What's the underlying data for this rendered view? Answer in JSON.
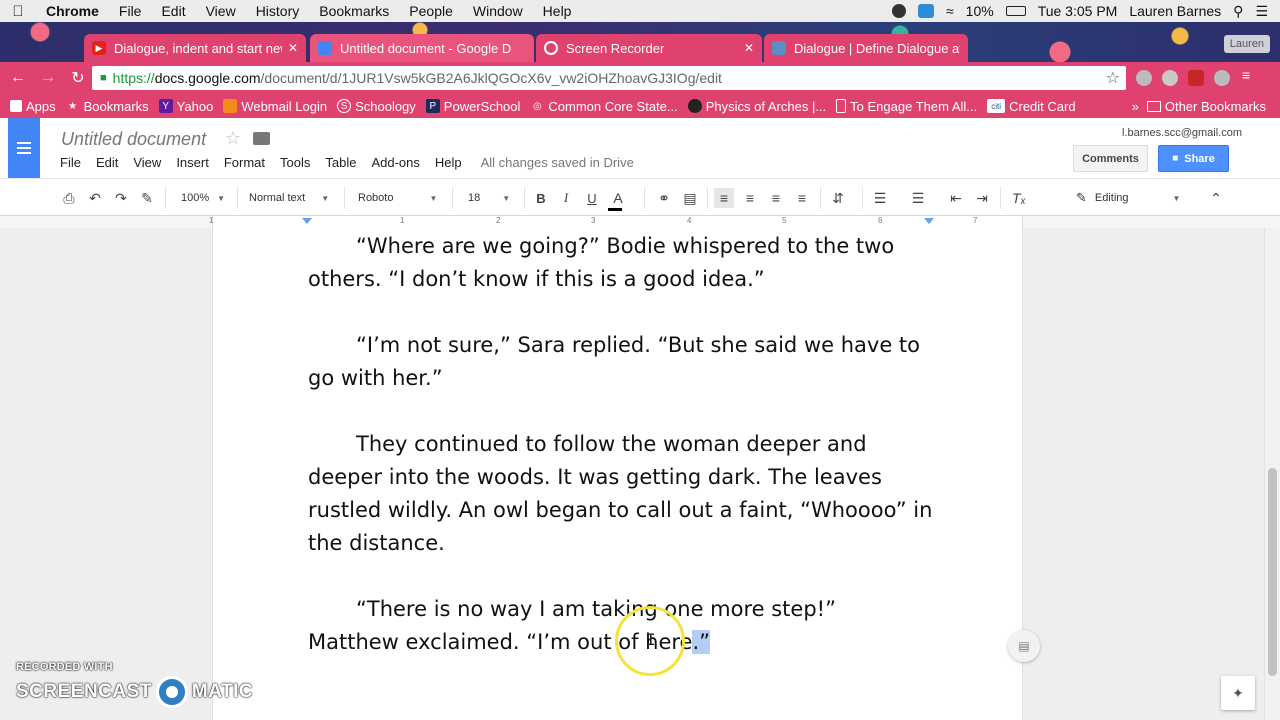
{
  "mac_menu": {
    "app": "Chrome",
    "items": [
      "File",
      "Edit",
      "View",
      "History",
      "Bookmarks",
      "People",
      "Window",
      "Help"
    ],
    "battery": "10%",
    "clock": "Tue 3:05 PM",
    "user": "Lauren Barnes"
  },
  "tabs": [
    {
      "title": "Dialogue, indent and start new",
      "icon": "youtube-icon"
    },
    {
      "title": "Untitled document - Google D",
      "icon": "docs-icon"
    },
    {
      "title": "Screen Recorder",
      "icon": "recorder-icon"
    },
    {
      "title": "Dialogue | Define Dialogue at D",
      "icon": "dictionary-icon"
    }
  ],
  "profile_label": "Lauren",
  "omnibox": {
    "scheme": "https://",
    "host": "docs.google.com",
    "path": "/document/d/1JUR1Vsw5kGB2A6JklQGOcX6v_vw2iOHZhoavGJ3IOg/edit"
  },
  "bookmarks": [
    {
      "label": "Apps",
      "icon": "apps-grid-icon"
    },
    {
      "label": "Bookmarks",
      "icon": "star-icon"
    },
    {
      "label": "Yahoo",
      "icon": "yahoo-icon"
    },
    {
      "label": "Webmail Login",
      "icon": "webmail-icon"
    },
    {
      "label": "Schoology",
      "icon": "schoology-icon"
    },
    {
      "label": "PowerSchool",
      "icon": "powerschool-icon"
    },
    {
      "label": "Common Core State...",
      "icon": "commoncore-icon"
    },
    {
      "label": "Physics of Arches |...",
      "icon": "pbs-icon"
    },
    {
      "label": "To Engage Them All...",
      "icon": "page-icon"
    },
    {
      "label": "Credit Card",
      "icon": "citi-icon"
    }
  ],
  "other_bookmarks": "Other Bookmarks",
  "docs": {
    "title": "Untitled document",
    "menus": [
      "File",
      "Edit",
      "View",
      "Insert",
      "Format",
      "Tools",
      "Table",
      "Add-ons",
      "Help"
    ],
    "save_status": "All changes saved in Drive",
    "account": "l.barnes.scc@gmail.com",
    "comments_label": "Comments",
    "share_label": "Share"
  },
  "toolbar": {
    "zoom": "100%",
    "style": "Normal text",
    "font": "Roboto",
    "size": "18",
    "mode": "Editing"
  },
  "ruler_numbers": [
    "1",
    "1",
    "2",
    "3",
    "4",
    "5",
    "6",
    "7"
  ],
  "document": {
    "paragraphs": [
      "“Where are we going?” Bodie whispered to the two others. “I don’t know if this is a good idea.”",
      "“I’m not sure,” Sara replied. “But she said we have to go with her.”",
      "They continued to follow the woman deeper and deeper into the woods. It was getting dark. The leaves rustled wildly. An owl began to call out a faint, “Whoooo” in the distance."
    ],
    "last_paragraph_before_selection": "“There is no way I am taking one more step!” Matthew exclaimed. “I’m out of here",
    "selected_text": ".”"
  },
  "watermark": {
    "line1": "RECORDED WITH",
    "left": "SCREENCAST",
    "right": "MATIC"
  }
}
